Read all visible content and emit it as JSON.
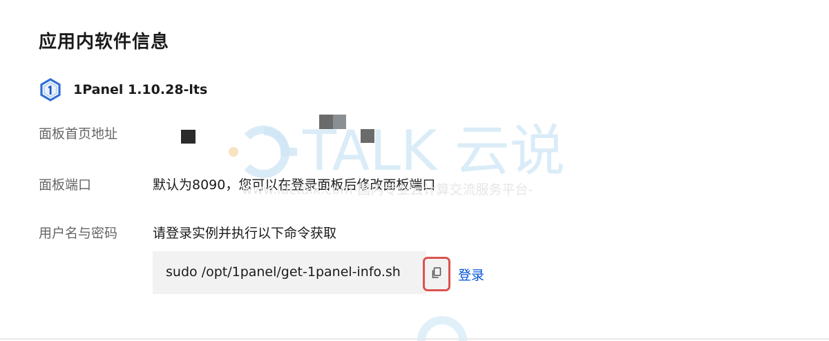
{
  "section": {
    "title": "应用内软件信息"
  },
  "product": {
    "logo_icon": "1panel-logo-icon",
    "name": "1Panel 1.10.28-lts"
  },
  "rows": {
    "panel_url": {
      "label": "面板首页地址"
    },
    "panel_port": {
      "label": "面板端口",
      "value": "默认为8090，您可以在登录面板后修改面板端口"
    },
    "credentials": {
      "label": "用户名与密码",
      "value": "请登录实例并执行以下命令获取"
    }
  },
  "command": {
    "text": "sudo /opt/1panel/get-1panel-info.sh",
    "copy_icon": "copy-icon"
  },
  "actions": {
    "login_label": "登录"
  },
  "watermark": {
    "brand": "TALK 云说",
    "tagline": "www.idctalk.com-国内专业云计算交流服务平台-"
  },
  "colors": {
    "link": "#0052d9",
    "highlight_border": "#d9534f",
    "logo": "#2f6fd6"
  }
}
